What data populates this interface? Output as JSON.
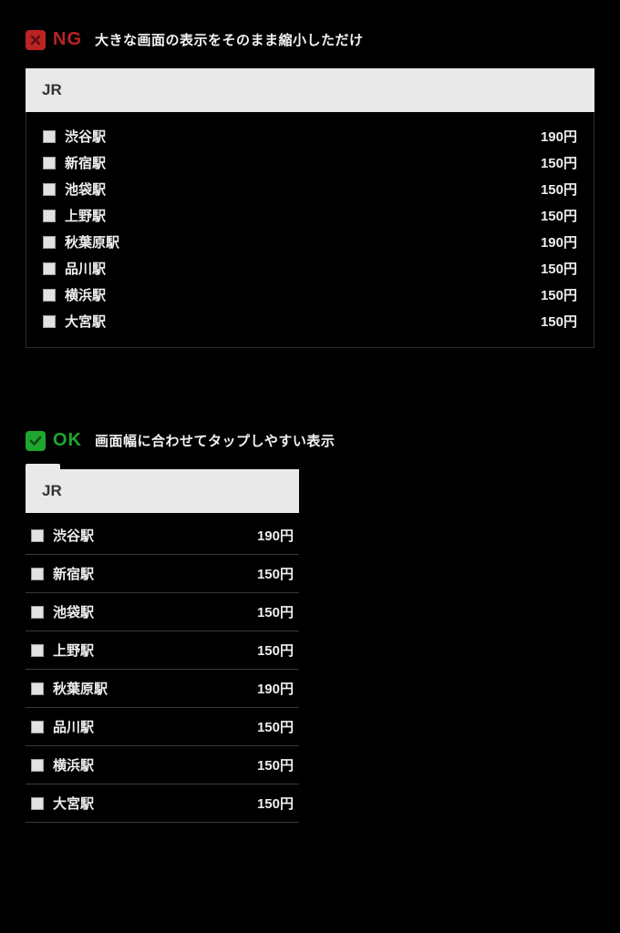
{
  "ng": {
    "label": "NG",
    "desc": "大きな画面の表示をそのまま縮小しただけ",
    "header": "JR",
    "rows": [
      {
        "name": "渋谷駅",
        "amount": "190円"
      },
      {
        "name": "新宿駅",
        "amount": "150円"
      },
      {
        "name": "池袋駅",
        "amount": "150円"
      },
      {
        "name": "上野駅",
        "amount": "150円"
      },
      {
        "name": "秋葉原駅",
        "amount": "190円"
      },
      {
        "name": "品川駅",
        "amount": "150円"
      },
      {
        "name": "横浜駅",
        "amount": "150円"
      },
      {
        "name": "大宮駅",
        "amount": "150円"
      }
    ]
  },
  "ok": {
    "label": "OK",
    "desc": "画面幅に合わせてタップしやすい表示",
    "header": "JR",
    "rows": [
      {
        "name": "渋谷駅",
        "amount": "190円"
      },
      {
        "name": "新宿駅",
        "amount": "150円"
      },
      {
        "name": "池袋駅",
        "amount": "150円"
      },
      {
        "name": "上野駅",
        "amount": "150円"
      },
      {
        "name": "秋葉原駅",
        "amount": "190円"
      },
      {
        "name": "品川駅",
        "amount": "150円"
      },
      {
        "name": "横浜駅",
        "amount": "150円"
      },
      {
        "name": "大宮駅",
        "amount": "150円"
      }
    ]
  }
}
